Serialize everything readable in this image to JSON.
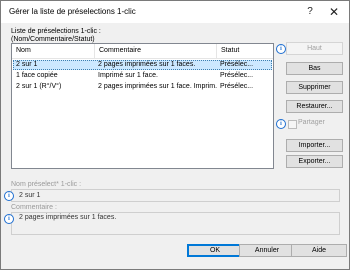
{
  "window": {
    "title": "Gérer la liste de préselections 1-clic",
    "help_glyph": "?",
    "close_glyph": "✕"
  },
  "list": {
    "caption_line1": "Liste de préselections 1-clic :",
    "caption_line2": "(Nom/Commentaire/Statut)",
    "columns": [
      "Nom",
      "Commentaire",
      "Statut"
    ],
    "rows": [
      {
        "name": "2 sur 1",
        "comment": "2 pages imprimées sur 1 faces.",
        "status": "Présélec...",
        "selected": true
      },
      {
        "name": "1 face copiée",
        "comment": "Imprimé sur 1 face.",
        "status": "Présélec...",
        "selected": false
      },
      {
        "name": "2 sur 1 (R°/V°)",
        "comment": "2 pages imprimées sur 1 face. Imprim...",
        "status": "Présélec...",
        "selected": false
      }
    ]
  },
  "buttons": {
    "up": "Haut",
    "down": "Bas",
    "delete": "Supprimer",
    "restore": "Restaurer...",
    "import": "Importer...",
    "export": "Exporter...",
    "ok": "OK",
    "cancel": "Annuler",
    "help": "Aide"
  },
  "share": {
    "label": "Partager",
    "checked": false
  },
  "preset_name": {
    "label": "Nom préselect* 1-clic :",
    "value": "2 sur 1"
  },
  "comment": {
    "label": "Commentaire :",
    "value": "2 pages imprimées sur 1 faces."
  },
  "icons": {
    "info": "info-icon",
    "info_glyph": "i"
  },
  "colors": {
    "selection": "#cce8ff",
    "accent": "#0078d7",
    "info": "#1f6fd1"
  }
}
